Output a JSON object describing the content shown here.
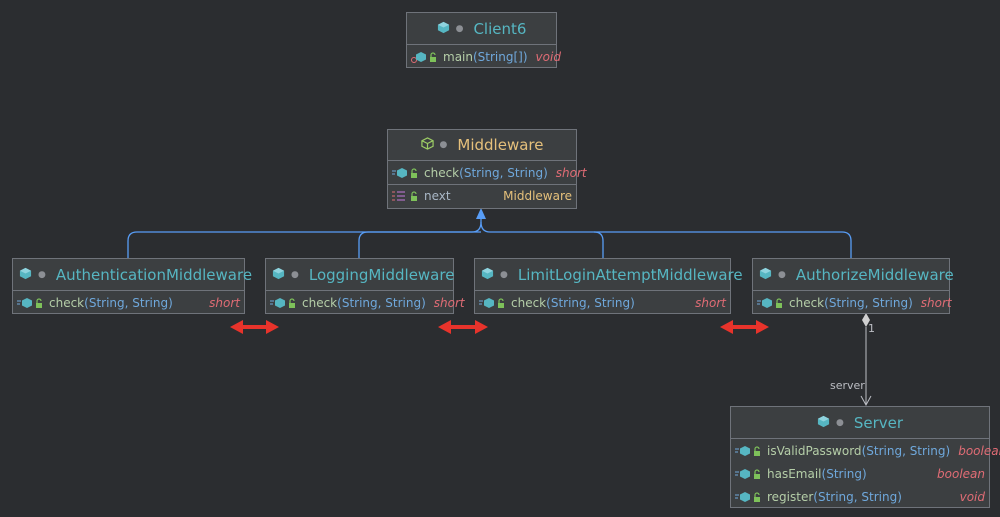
{
  "classes": {
    "client6": {
      "name": "Client6",
      "methods": [
        {
          "name": "main",
          "params": "String[]",
          "ret": "void"
        }
      ]
    },
    "middleware": {
      "name": "Middleware",
      "methods": [
        {
          "name": "check",
          "params": "String, String",
          "ret": "short"
        }
      ],
      "fields": [
        {
          "name": "next",
          "type": "Middleware"
        }
      ]
    },
    "authentication": {
      "name": "AuthenticationMiddleware",
      "methods": [
        {
          "name": "check",
          "params": "String, String",
          "ret": "short"
        }
      ]
    },
    "logging": {
      "name": "LoggingMiddleware",
      "methods": [
        {
          "name": "check",
          "params": "String, String",
          "ret": "short"
        }
      ]
    },
    "limitlogin": {
      "name": "LimitLoginAttemptMiddleware",
      "methods": [
        {
          "name": "check",
          "params": "String, String",
          "ret": "short"
        }
      ]
    },
    "authorize": {
      "name": "AuthorizeMiddleware",
      "methods": [
        {
          "name": "check",
          "params": "String, String",
          "ret": "short"
        }
      ]
    },
    "server": {
      "name": "Server",
      "methods": [
        {
          "name": "isValidPassword",
          "params": "String, String",
          "ret": "boolean"
        },
        {
          "name": "hasEmail",
          "params": "String",
          "ret": "boolean"
        },
        {
          "name": "register",
          "params": "String, String",
          "ret": "void"
        }
      ]
    }
  },
  "edge_labels": {
    "multiplicity": "1",
    "role": "server"
  },
  "colors": {
    "background": "#2b2d30",
    "box": "#3c3f41",
    "class_name": "#56b6c2",
    "abstract_name": "#e5c07b",
    "inheritance_edge": "#589df6",
    "double_arrow": "#e8332b",
    "return_type": "#e06c75"
  },
  "icons": {
    "class": "class-icon",
    "abstract_class": "abstract-class-icon",
    "method": "method-icon",
    "field": "field-icon",
    "public": "lock-open-icon",
    "static": "static-icon"
  }
}
